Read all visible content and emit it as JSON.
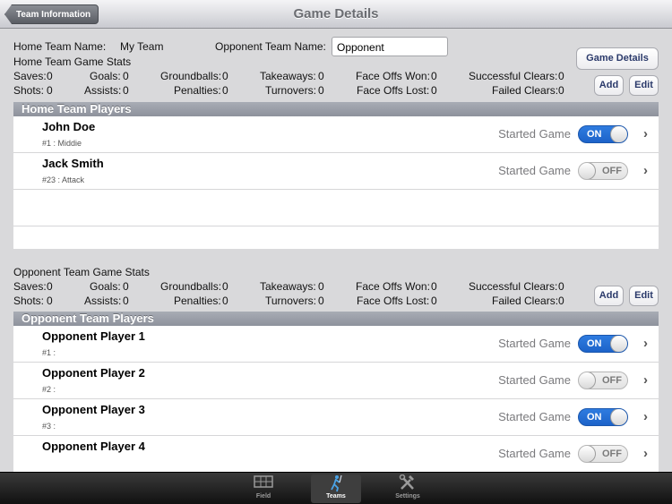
{
  "nav": {
    "back_label": "Team Information",
    "title": "Game Details"
  },
  "home": {
    "name_label": "Home Team Name:",
    "name_value": "My Team",
    "stats_title": "Home Team Game Stats",
    "stats": {
      "saves": "Saves:",
      "saves_v": "0",
      "goals": "Goals:",
      "goals_v": "0",
      "groundballs": "Groundballs:",
      "groundballs_v": "0",
      "takeaways": "Takeaways:",
      "takeaways_v": "0",
      "faceoffs_won": "Face Offs Won:",
      "faceoffs_won_v": "0",
      "clears_ok": "Successful Clears:",
      "clears_ok_v": "0",
      "shots": "Shots:",
      "shots_v": "0",
      "assists": "Assists:",
      "assists_v": "0",
      "penalties": "Penalties:",
      "penalties_v": "0",
      "turnovers": "Turnovers:",
      "turnovers_v": "0",
      "faceoffs_lost": "Face Offs Lost:",
      "faceoffs_lost_v": "0",
      "clears_fail": "Failed Clears:",
      "clears_fail_v": "0"
    },
    "section_title": "Home Team Players",
    "players": [
      {
        "name": "John Doe",
        "sub": "#1 : Middie",
        "started": "Started Game",
        "state": "ON"
      },
      {
        "name": "Jack Smith",
        "sub": "#23 : Attack",
        "started": "Started Game",
        "state": "OFF"
      }
    ]
  },
  "opponent": {
    "name_label": "Opponent Team Name:",
    "name_value": "Opponent",
    "stats_title": "Opponent Team Game Stats",
    "stats": {
      "saves": "Saves:",
      "saves_v": "0",
      "goals": "Goals:",
      "goals_v": "0",
      "groundballs": "Groundballs:",
      "groundballs_v": "0",
      "takeaways": "Takeaways:",
      "takeaways_v": "0",
      "faceoffs_won": "Face Offs Won:",
      "faceoffs_won_v": "0",
      "clears_ok": "Successful Clears:",
      "clears_ok_v": "0",
      "shots": "Shots:",
      "shots_v": "0",
      "assists": "Assists:",
      "assists_v": "0",
      "penalties": "Penalties:",
      "penalties_v": "0",
      "turnovers": "Turnovers:",
      "turnovers_v": "0",
      "faceoffs_lost": "Face Offs Lost:",
      "faceoffs_lost_v": "0",
      "clears_fail": "Failed Clears:",
      "clears_fail_v": "0"
    },
    "section_title": "Opponent Team Players",
    "players": [
      {
        "name": "Opponent Player 1",
        "sub": "#1 :",
        "started": "Started Game",
        "state": "ON"
      },
      {
        "name": "Opponent Player 2",
        "sub": "#2 :",
        "started": "Started Game",
        "state": "OFF"
      },
      {
        "name": "Opponent Player 3",
        "sub": "#3 :",
        "started": "Started Game",
        "state": "ON"
      },
      {
        "name": "Opponent Player 4",
        "sub": "",
        "started": "Started Game",
        "state": "OFF"
      }
    ]
  },
  "buttons": {
    "game_details": "Game Details",
    "add": "Add",
    "edit": "Edit"
  },
  "tabs": [
    {
      "label": "Field",
      "icon": "field-icon"
    },
    {
      "label": "Teams",
      "icon": "lacrosse-player-icon"
    },
    {
      "label": "Settings",
      "icon": "tools-icon"
    }
  ],
  "colors": {
    "switch_on": "#1d63c9",
    "section_header": "#8e929c"
  }
}
